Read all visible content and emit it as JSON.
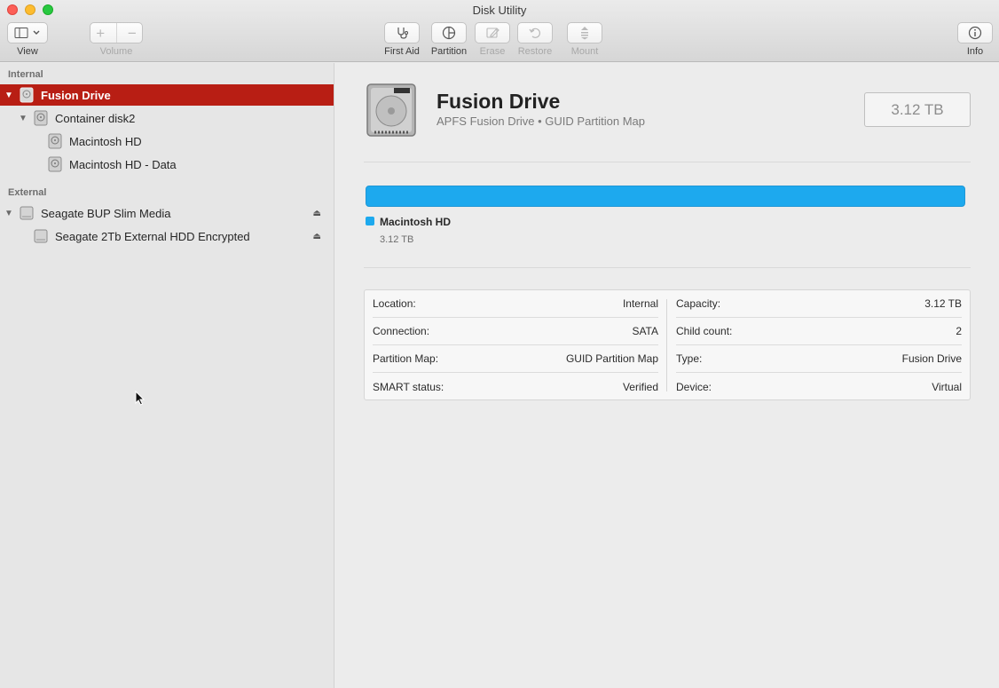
{
  "window": {
    "title": "Disk Utility"
  },
  "toolbar": {
    "view_label": "View",
    "volume_label": "Volume",
    "volume_add": "+",
    "volume_remove": "−",
    "first_aid_label": "First Aid",
    "partition_label": "Partition",
    "erase_label": "Erase",
    "restore_label": "Restore",
    "mount_label": "Mount",
    "info_label": "Info"
  },
  "sidebar": {
    "internal_header": "Internal",
    "external_header": "External",
    "internal_items": [
      {
        "label": "Fusion Drive",
        "selected": true
      },
      {
        "label": "Container disk2"
      },
      {
        "label": "Macintosh HD"
      },
      {
        "label": "Macintosh HD - Data"
      }
    ],
    "external_items": [
      {
        "label": "Seagate BUP Slim Media"
      },
      {
        "label": "Seagate 2Tb External HDD Encrypted"
      }
    ]
  },
  "detail": {
    "title": "Fusion Drive",
    "subtitle": "APFS Fusion Drive • GUID Partition Map",
    "capacity_badge": "3.12 TB",
    "usage": {
      "name": "Macintosh HD",
      "size": "3.12 TB",
      "fraction": 1.0,
      "color": "#1da9ee"
    },
    "info_left": [
      {
        "label": "Location:",
        "value": "Internal"
      },
      {
        "label": "Connection:",
        "value": "SATA"
      },
      {
        "label": "Partition Map:",
        "value": "GUID Partition Map"
      },
      {
        "label": "SMART status:",
        "value": "Verified"
      }
    ],
    "info_right": [
      {
        "label": "Capacity:",
        "value": "3.12 TB"
      },
      {
        "label": "Child count:",
        "value": "2"
      },
      {
        "label": "Type:",
        "value": "Fusion Drive"
      },
      {
        "label": "Device:",
        "value": "Virtual"
      }
    ]
  },
  "colors": {
    "selection": "#b81e14",
    "accent": "#1da9ee"
  }
}
